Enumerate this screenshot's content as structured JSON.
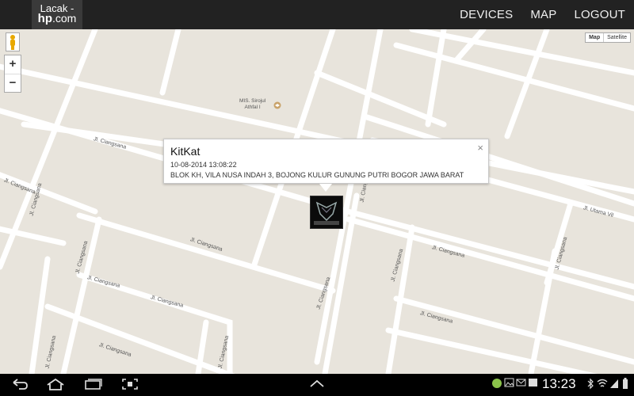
{
  "header": {
    "logo_line1": "Lacak -",
    "logo_line2_a": "hp",
    "logo_line2_b": ".com",
    "nav": [
      "DEVICES",
      "MAP",
      "LOGOUT"
    ]
  },
  "map": {
    "type_map": "Map",
    "type_satellite": "Satellite",
    "zoom_in": "+",
    "zoom_out": "−",
    "poi": [
      "MIS. Sirojul",
      "Athfal I"
    ],
    "streets": [
      "Jl. Ciangsana",
      "Jl. Ciangsana",
      "Jl. Ciangsana",
      "Jl. Ciangsana",
      "Jl. Ciangsana",
      "Jl. Ciangsana",
      "Jl. Ciangsana",
      "Jl. Ciangsana",
      "Jl. Ciangsana",
      "Jl. Ciangsana",
      "Jl. Ciangsana",
      "Jl. Ciangsana",
      "Jl. Ciangsana",
      "Jl. Ciangsana",
      "Jl. Ciangsana",
      "Jl. Ciangsana",
      "Jl. Utama Vil"
    ]
  },
  "popup": {
    "title": "KitKat",
    "time": "10-08-2014 13:08:22",
    "address": "BLOK KH, VILA NUSA INDAH 3, BOJONG KULUR GUNUNG PUTRI BOGOR JAWA BARAT",
    "close": "×"
  },
  "system_bar": {
    "time": "13:23",
    "icons": [
      "back-icon",
      "home-icon",
      "recent-apps-icon",
      "screenshot-icon",
      "chevron-up-icon",
      "android-icon",
      "image-icon",
      "mail-icon",
      "bluetooth-icon",
      "wifi-icon",
      "signal-icon",
      "battery-icon"
    ]
  }
}
